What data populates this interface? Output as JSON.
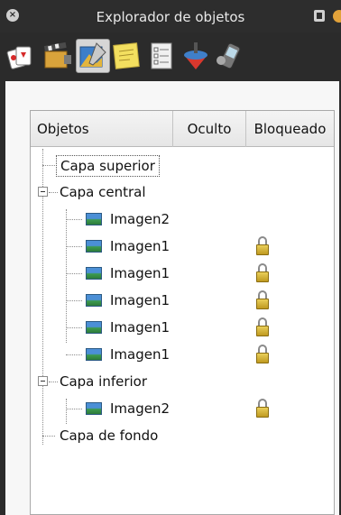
{
  "window": {
    "title": "Explorador de objetos"
  },
  "toolbar": {
    "tools": [
      {
        "icon": "cards-icon",
        "active": false
      },
      {
        "icon": "clapperboard-icon",
        "active": false
      },
      {
        "icon": "image-editor-icon",
        "active": true
      },
      {
        "icon": "sticky-note-icon",
        "active": false
      },
      {
        "icon": "checklist-icon",
        "active": false
      },
      {
        "icon": "spinning-top-icon",
        "active": false
      },
      {
        "icon": "mobile-device-icon",
        "active": false
      }
    ]
  },
  "tree": {
    "columns": [
      "Objetos",
      "Oculto",
      "Bloqueado"
    ],
    "rows": [
      {
        "label": "Capa superior",
        "level": 0,
        "expandable": false,
        "selected": true,
        "icon": null,
        "locked": false
      },
      {
        "label": "Capa central",
        "level": 0,
        "expandable": true,
        "selected": false,
        "icon": null,
        "locked": false
      },
      {
        "label": "Imagen2",
        "level": 1,
        "expandable": false,
        "selected": false,
        "icon": "image-icon",
        "locked": false
      },
      {
        "label": "Imagen1",
        "level": 1,
        "expandable": false,
        "selected": false,
        "icon": "image-icon",
        "locked": true
      },
      {
        "label": "Imagen1",
        "level": 1,
        "expandable": false,
        "selected": false,
        "icon": "image-icon",
        "locked": true
      },
      {
        "label": "Imagen1",
        "level": 1,
        "expandable": false,
        "selected": false,
        "icon": "image-icon",
        "locked": true
      },
      {
        "label": "Imagen1",
        "level": 1,
        "expandable": false,
        "selected": false,
        "icon": "image-icon",
        "locked": true
      },
      {
        "label": "Imagen1",
        "level": 1,
        "expandable": false,
        "selected": false,
        "icon": "image-icon",
        "locked": true
      },
      {
        "label": "Capa inferior",
        "level": 0,
        "expandable": true,
        "selected": false,
        "icon": null,
        "locked": false
      },
      {
        "label": "Imagen2",
        "level": 1,
        "expandable": false,
        "selected": false,
        "icon": "image-icon",
        "locked": true
      },
      {
        "label": "Capa de fondo",
        "level": 0,
        "expandable": false,
        "selected": false,
        "icon": null,
        "locked": false
      }
    ]
  },
  "colors": {
    "frame": "#2b2b2b",
    "panel": "#f7f7f7",
    "lock": "#d9b83c",
    "image_sky": "#4b8fd6",
    "image_grass": "#3c9b4f"
  }
}
